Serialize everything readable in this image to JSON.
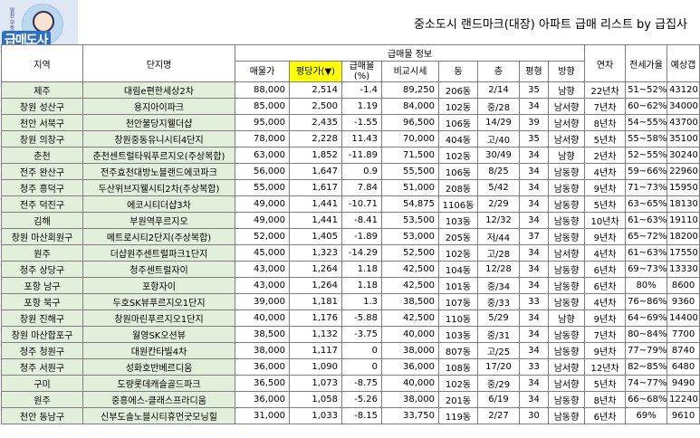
{
  "logo": {
    "text_small": "알찬 부동산",
    "text_big": "급매도사"
  },
  "title": "중소도시 랜드마크(대장) 아파트 급매 리스트 by 급집사",
  "headers": {
    "region": "지역",
    "complex": "단지명",
    "group": "급매물 정보",
    "price": "매물가",
    "per_pyeong": "평당가(▼)",
    "ratio": "급매율\n(%)",
    "market": "비교시세",
    "dong": "동",
    "floor": "층",
    "pyeong": "평형",
    "direction": "방향",
    "age": "연차",
    "jeonse": "전세가율",
    "gap": "예상갭"
  },
  "rows": [
    {
      "region": "제주",
      "complex": "대림e편한세상2차",
      "price": "88,000",
      "per": "2,514",
      "ratio": "-1.4",
      "market": "89,250",
      "dong": "206동",
      "floor": "2/14",
      "pyeong": "35",
      "dir": "남향",
      "age": "22년차",
      "jeonse": "51~52%",
      "gap": "43120"
    },
    {
      "region": "창원 성산구",
      "complex": "용지아이파크",
      "price": "85,000",
      "per": "2,500",
      "ratio": "1.19",
      "market": "84,000",
      "dong": "102동",
      "floor": "중/28",
      "pyeong": "34",
      "dir": "남서향",
      "age": "7년차",
      "jeonse": "60~62%",
      "gap": "34000"
    },
    {
      "region": "천안 서북구",
      "complex": "천안불당지웰더샵",
      "price": "95,000",
      "per": "2,435",
      "ratio": "-1.55",
      "market": "96,500",
      "dong": "106동",
      "floor": "14/29",
      "pyeong": "39",
      "dir": "남서향",
      "age": "8년차",
      "jeonse": "54~55%",
      "gap": "43700"
    },
    {
      "region": "창원 의창구",
      "complex": "창원중동유니시티4단지",
      "price": "78,000",
      "per": "2,228",
      "ratio": "11.43",
      "market": "70,000",
      "dong": "404동",
      "floor": "고/40",
      "pyeong": "35",
      "dir": "남서향",
      "age": "5년차",
      "jeonse": "55~58%",
      "gap": "35100"
    },
    {
      "region": "춘천",
      "complex": "춘천센트럴타워푸르지오(주상복합)",
      "price": "63,000",
      "per": "1,852",
      "ratio": "-11.89",
      "market": "71,500",
      "dong": "102동",
      "floor": "30/49",
      "pyeong": "34",
      "dir": "남향",
      "age": "2년차",
      "jeonse": "52~55%",
      "gap": "30240"
    },
    {
      "region": "전주 완산구",
      "complex": "전주효천대방노블랜드에코파크",
      "price": "56,000",
      "per": "1,647",
      "ratio": "0.9",
      "market": "55,500",
      "dong": "106동",
      "floor": "8/25",
      "pyeong": "34",
      "dir": "남동향",
      "age": "4년차",
      "jeonse": "59~66%",
      "gap": "22960"
    },
    {
      "region": "청주 흥덕구",
      "complex": "두산위브지웰시티2차(주상복합)",
      "price": "55,000",
      "per": "1,617",
      "ratio": "7.84",
      "market": "51,000",
      "dong": "208동",
      "floor": "5/42",
      "pyeong": "34",
      "dir": "남동향",
      "age": "9년차",
      "jeonse": "71~73%",
      "gap": "15950"
    },
    {
      "region": "전주 덕진구",
      "complex": "에코시티더샵3차",
      "price": "49,000",
      "per": "1,441",
      "ratio": "-10.71",
      "market": "54,875",
      "dong": "1106동",
      "floor": "2/29",
      "pyeong": "34",
      "dir": "남동향",
      "age": "5년차",
      "jeonse": "63~65%",
      "gap": "18130"
    },
    {
      "region": "김해",
      "complex": "부원역푸르지오",
      "price": "49,000",
      "per": "1,441",
      "ratio": "-8.41",
      "market": "53,500",
      "dong": "103동",
      "floor": "12/32",
      "pyeong": "34",
      "dir": "남동향",
      "age": "10년차",
      "jeonse": "61~63%",
      "gap": "19110"
    },
    {
      "region": "창원 마산회원구",
      "complex": "메트로시티2단지(주상복합)",
      "price": "52,000",
      "per": "1,405",
      "ratio": "-1.89",
      "market": "53,000",
      "dong": "205동",
      "floor": "저/44",
      "pyeong": "37",
      "dir": "남동향",
      "age": "9년차",
      "jeonse": "65~72%",
      "gap": "18200"
    },
    {
      "region": "원주",
      "complex": "더샵원주센트럴파크1단지",
      "price": "45,000",
      "per": "1,323",
      "ratio": "-14.29",
      "market": "52,500",
      "dong": "102동",
      "floor": "고/28",
      "pyeong": "34",
      "dir": "남서향",
      "age": "4년차",
      "jeonse": "61~63%",
      "gap": "17550"
    },
    {
      "region": "청주 상당구",
      "complex": "청주센트럴자이",
      "price": "43,000",
      "per": "1,264",
      "ratio": "1.18",
      "market": "42,500",
      "dong": "104동",
      "floor": "12/28",
      "pyeong": "34",
      "dir": "남동향",
      "age": "6년차",
      "jeonse": "69~73%",
      "gap": "13330"
    },
    {
      "region": "포항 남구",
      "complex": "포항자이",
      "price": "43,000",
      "per": "1,264",
      "ratio": "1.18",
      "market": "42,500",
      "dong": "101동",
      "floor": "중/34",
      "pyeong": "34",
      "dir": "남동향",
      "age": "6년차",
      "jeonse": "80%",
      "gap": "8600"
    },
    {
      "region": "포항 북구",
      "complex": "두호SK뷰푸르지오1단지",
      "price": "39,000",
      "per": "1,181",
      "ratio": "1.3",
      "market": "38,500",
      "dong": "107동",
      "floor": "중/33",
      "pyeong": "33",
      "dir": "남동향",
      "age": "4년차",
      "jeonse": "76~86%",
      "gap": "9360"
    },
    {
      "region": "창원 진해구",
      "complex": "창원마린푸르지오1단지",
      "price": "40,000",
      "per": "1,176",
      "ratio": "-5.88",
      "market": "42,500",
      "dong": "110동",
      "floor": "5/29",
      "pyeong": "34",
      "dir": "남향",
      "age": "9년차",
      "jeonse": "64~69%",
      "gap": "14400"
    },
    {
      "region": "창원 마산합포구",
      "complex": "월영SK오션뷰",
      "price": "38,500",
      "per": "1,132",
      "ratio": "-3.75",
      "market": "40,000",
      "dong": "103동",
      "floor": "중/31",
      "pyeong": "34",
      "dir": "남동향",
      "age": "7년차",
      "jeonse": "80~84%",
      "gap": "7700"
    },
    {
      "region": "청주 청원구",
      "complex": "대원칸타빌4차",
      "price": "38,000",
      "per": "1,117",
      "ratio": "0",
      "market": "38,000",
      "dong": "807동",
      "floor": "고/25",
      "pyeong": "34",
      "dir": "남동향",
      "age": "9년차",
      "jeonse": "77~79%",
      "gap": "8740"
    },
    {
      "region": "청주 서원구",
      "complex": "성화호반베르디움",
      "price": "36,000",
      "per": "1,090",
      "ratio": "0",
      "market": "36,000",
      "dong": "108동",
      "floor": "17/20",
      "pyeong": "33",
      "dir": "남서향",
      "age": "12년차",
      "jeonse": "82~85%",
      "gap": "6480"
    },
    {
      "region": "구미",
      "complex": "도량롯데캐슬골드파크",
      "price": "36,500",
      "per": "1,073",
      "ratio": "-8.75",
      "market": "40,000",
      "dong": "102동",
      "floor": "중/29",
      "pyeong": "34",
      "dir": "남서향",
      "age": "5년차",
      "jeonse": "74~77%",
      "gap": "9490"
    },
    {
      "region": "원주",
      "complex": "중흥에스-클래스프라디움",
      "price": "36,000",
      "per": "1,058",
      "ratio": "-5.26",
      "market": "38,000",
      "dong": "201동",
      "floor": "6/19",
      "pyeong": "34",
      "dir": "남동향",
      "age": "8년차",
      "jeonse": "66~68%",
      "gap": "12240"
    },
    {
      "region": "천안 동남구",
      "complex": "신부도솔노블시티휴먼굿모닝힐",
      "price": "31,000",
      "per": "1,033",
      "ratio": "-8.15",
      "market": "33,750",
      "dong": "119동",
      "floor": "2/27",
      "pyeong": "30",
      "dir": "남동향",
      "age": "6년차",
      "jeonse": "69%",
      "gap": "9610"
    }
  ]
}
